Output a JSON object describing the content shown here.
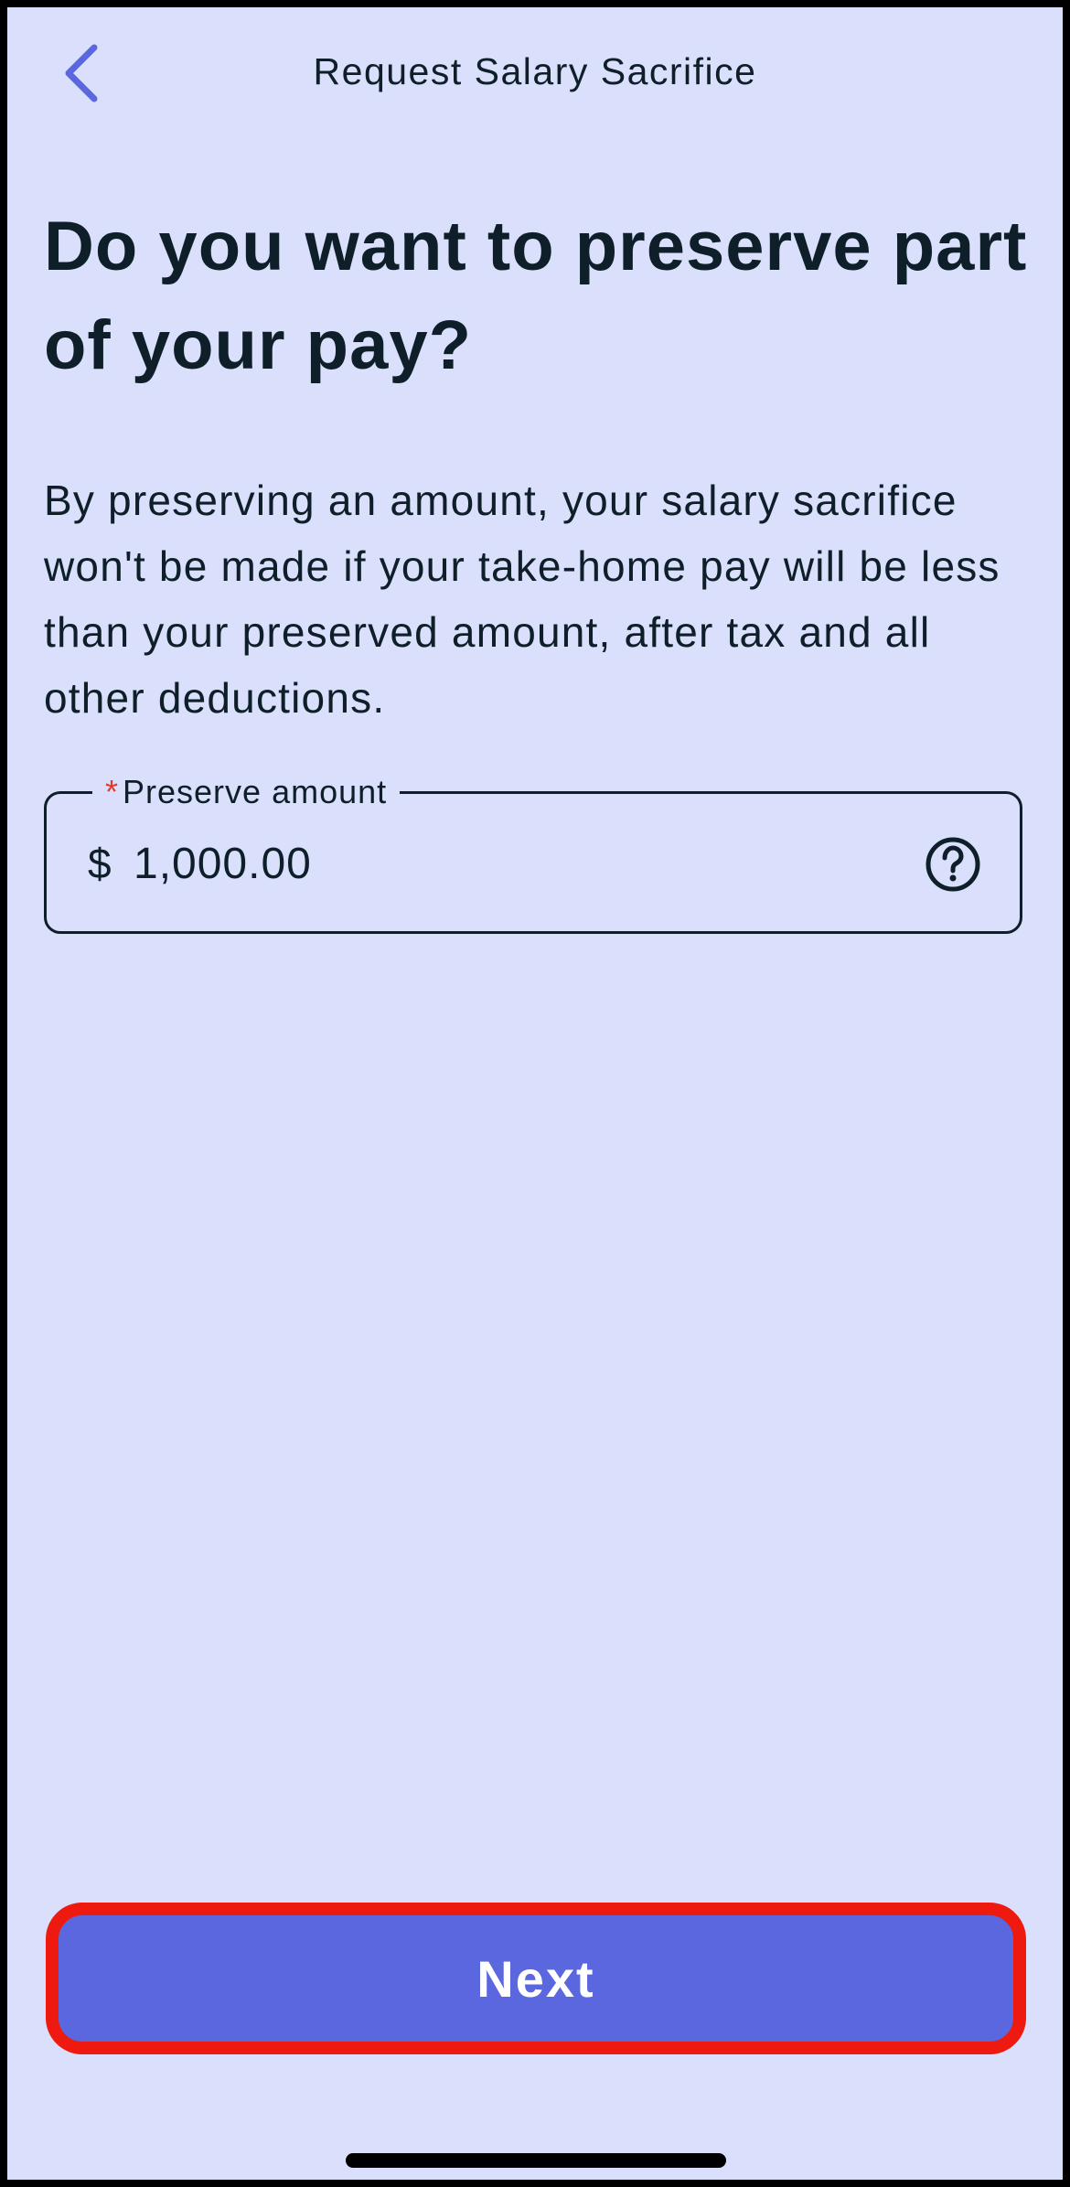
{
  "header": {
    "back_icon": "chevron-left-icon",
    "title": "Request Salary Sacrifice"
  },
  "main": {
    "headline": "Do you want to preserve part of your pay?",
    "description": "By preserving an amount, your salary sacrifice won't be made if your take-home pay will be less than your preserved amount, after tax and all other deductions."
  },
  "preserve_field": {
    "required_marker": "*",
    "label": "Preserve amount",
    "currency_symbol": "$",
    "value": "1,000.00",
    "help_icon": "question-circle-icon"
  },
  "footer": {
    "next_label": "Next"
  },
  "colors": {
    "background": "#dadffb",
    "primary_button": "#5a67df",
    "highlight_border": "#ee1a0f",
    "text": "#0e1f2a",
    "back_icon": "#5a67df",
    "required": "#e03a2f"
  }
}
